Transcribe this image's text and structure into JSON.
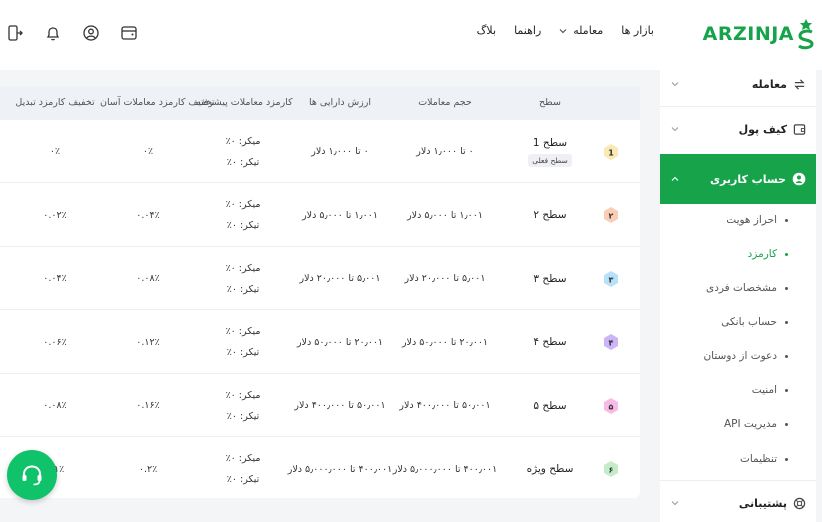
{
  "brand": {
    "name": "ARZINJA",
    "color": "#16a34a"
  },
  "nav": [
    {
      "label": "بازار ها",
      "has_dropdown": false
    },
    {
      "label": "معامله",
      "has_dropdown": true
    },
    {
      "label": "راهنما",
      "has_dropdown": false
    },
    {
      "label": "بلاگ",
      "has_dropdown": false
    }
  ],
  "header_icons": [
    "wallet-icon",
    "user-circle-icon",
    "bell-icon",
    "logout-icon"
  ],
  "sidebar": {
    "trade": "معامله",
    "wallet": "کیف پول",
    "account": "حساب کاربری",
    "sub_items": [
      "احراز هویت",
      "کارمزد",
      "مشخصات فردی",
      "حساب بانکی",
      "دعوت از دوستان",
      "امنیت",
      "مدیریت API",
      "تنظیمات"
    ],
    "current_sub": "کارمزد",
    "support": "پشتیبانی"
  },
  "table": {
    "headers": [
      "سطح",
      "حجم معاملات",
      "ارزش دارایی ها",
      "کارمزد معاملات پیشرفته",
      "تخفیف کارمزد معاملات آسان",
      "تخفیف کارمزد تبدیل"
    ],
    "current_tag": "سطح فعلی",
    "rows": [
      {
        "num": "1",
        "level": "سطح 1",
        "volume": "۰ تا ۱٫۰۰۰ دلار",
        "assets": "۰ تا ۱٫۰۰۰ دلار",
        "maker": "میکر: ۰٪",
        "taker": "تیکر: ۰٪",
        "easy": "۰٪",
        "convert": "۰٪",
        "color": "#f4d774",
        "current": true
      },
      {
        "num": "۲",
        "level": "سطح ۲",
        "volume": "۱٫۰۰۱ تا ۵٫۰۰۰ دلار",
        "assets": "۱٫۰۰۱ تا ۵٫۰۰۰ دلار",
        "maker": "میکر: ۰٪",
        "taker": "تیکر: ۰٪",
        "easy": "۰.۰۴٪",
        "convert": "۰.۰۲٪",
        "color": "#f6a57a",
        "current": false
      },
      {
        "num": "۳",
        "level": "سطح ۳",
        "volume": "۵٫۰۰۱ تا ۲۰٫۰۰۰ دلار",
        "assets": "۵٫۰۰۱ تا ۲۰٫۰۰۰ دلار",
        "maker": "میکر: ۰٪",
        "taker": "تیکر: ۰٪",
        "easy": "۰.۰۸٪",
        "convert": "۰.۰۴٪",
        "color": "#7cc6f4",
        "current": false
      },
      {
        "num": "۴",
        "level": "سطح ۴",
        "volume": "۲۰٫۰۰۱ تا ۵۰٫۰۰۰ دلار",
        "assets": "۲۰٫۰۰۱ تا ۵۰٫۰۰۰ دلار",
        "maker": "میکر: ۰٪",
        "taker": "تیکر: ۰٪",
        "easy": "۰.۱۲٪",
        "convert": "۰.۰۶٪",
        "color": "#a679f0",
        "current": false
      },
      {
        "num": "۵",
        "level": "سطح ۵",
        "volume": "۵۰٫۰۰۱ تا ۴۰۰٫۰۰۰ دلار",
        "assets": "۵۰٫۰۰۱ تا ۴۰۰٫۰۰۰ دلار",
        "maker": "میکر: ۰٪",
        "taker": "تیکر: ۰٪",
        "easy": "۰.۱۶٪",
        "convert": "۰.۰۸٪",
        "color": "#f284d4",
        "current": false
      },
      {
        "num": "۶",
        "level": "سطح ویژه",
        "volume": "۴۰۰٫۰۰۱ تا ۵٫۰۰۰٫۰۰۰ دلار",
        "assets": "۴۰۰٫۰۰۱ تا ۵٫۰۰۰٫۰۰۰ دلار",
        "maker": "میکر: ۰٪",
        "taker": "تیکر: ۰٪",
        "easy": "۰.۲٪",
        "convert": "۰.۱٪",
        "color": "#93dc9a",
        "current": false
      }
    ]
  }
}
